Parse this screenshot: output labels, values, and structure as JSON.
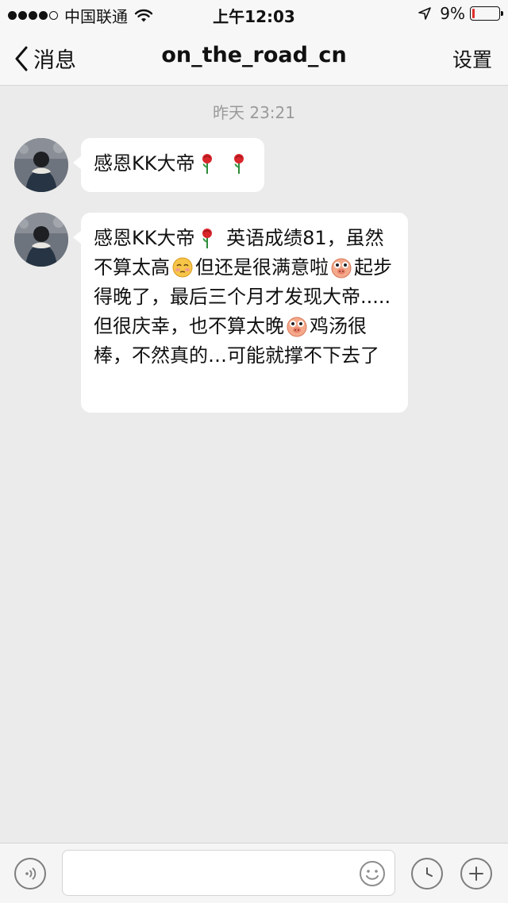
{
  "status_bar": {
    "carrier": "中国联通",
    "time": "上午12:03",
    "battery": "9%",
    "battery_level": 0.09,
    "signal_bars_filled": 4,
    "signal_bars_total": 5,
    "icons": [
      "wifi-icon",
      "location-arrow-icon",
      "battery-icon"
    ],
    "battery_color": "#e0312b"
  },
  "nav": {
    "back_label": "消息",
    "title": "on_the_road_cn",
    "settings_label": "设置"
  },
  "chat": {
    "timestamp": "昨天 23:21",
    "messages": [
      {
        "segments": [
          "感恩KK大帝",
          "[rose]",
          " ",
          "[rose]"
        ]
      },
      {
        "segments": [
          "感恩KK大帝",
          "[rose]",
          " 英语成绩81，虽然不算太高",
          "[shy-face]",
          "但还是很满意啦",
          "[pig-face]",
          "起步得晚了，最后三个月才发现大帝.....但很庆幸，也不算太晚",
          "[pig-face]",
          "鸡汤很棒，不然真的…可能就撑不下去了"
        ]
      }
    ]
  },
  "input_bar": {
    "icons": [
      "voice-icon",
      "emoji-icon",
      "clock-icon",
      "plus-icon"
    ],
    "placeholder": ""
  }
}
